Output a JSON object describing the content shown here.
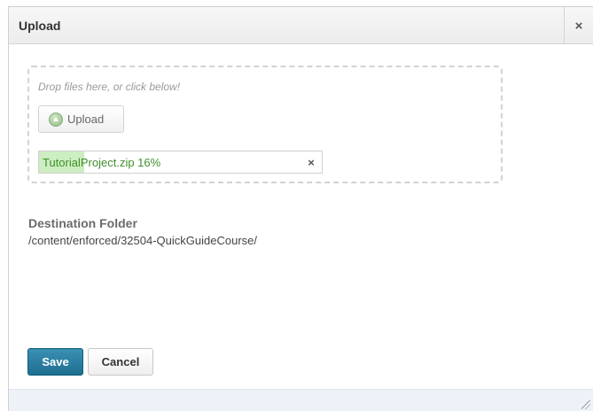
{
  "dialog": {
    "title": "Upload",
    "close_label": "×"
  },
  "dropzone": {
    "hint": "Drop files here, or click below!",
    "upload_button_label": "Upload"
  },
  "file": {
    "name_progress": "TutorialProject.zip 16%",
    "progress": 0.16,
    "remove_label": "×"
  },
  "destination": {
    "label": "Destination Folder",
    "path": "/content/enforced/32504-QuickGuideCourse/"
  },
  "buttons": {
    "save": "Save",
    "cancel": "Cancel"
  },
  "colors": {
    "primary": "#1f6e90",
    "progress_fill": "#cdeec0",
    "progress_text": "#3f8f2b"
  },
  "icons": {
    "upload": "upload-circle-icon",
    "close": "close-icon",
    "remove": "remove-icon",
    "resize": "resize-grip-icon"
  }
}
